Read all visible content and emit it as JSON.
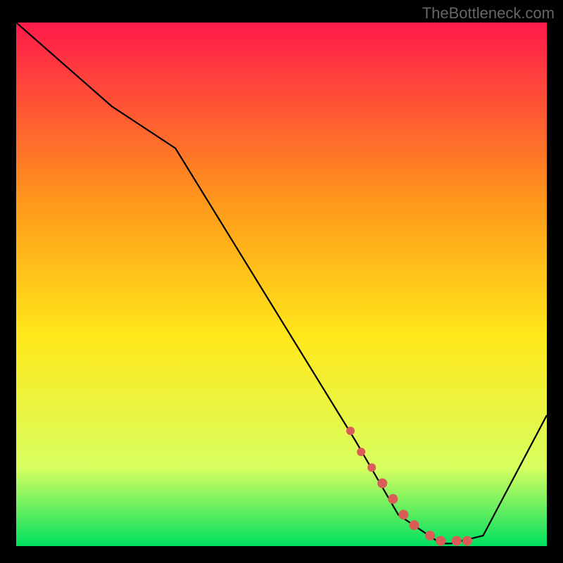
{
  "watermark": "TheBottleneck.com",
  "chart_data": {
    "type": "line",
    "title": "",
    "xlabel": "",
    "ylabel": "",
    "xlim": [
      0,
      100
    ],
    "ylim": [
      0,
      100
    ],
    "background": "rainbow-gradient-red-to-green-vertical",
    "series": [
      {
        "name": "curve",
        "color": "#000000",
        "x": [
          0,
          18,
          30,
          64,
          72,
          80,
          82,
          88,
          100
        ],
        "y": [
          100,
          84,
          76,
          20,
          6,
          0.5,
          0.5,
          2,
          25
        ]
      },
      {
        "name": "highlight-band",
        "color": "#d95c57",
        "type": "scatter",
        "x": [
          63,
          65,
          67,
          69,
          71,
          73,
          75,
          78,
          80,
          83,
          85
        ],
        "y": [
          22,
          18,
          15,
          12,
          9,
          6,
          4,
          2,
          1,
          1,
          1
        ]
      }
    ]
  },
  "colors": {
    "grad_top": "#ff1a4b",
    "grad_q1": "#ff9a1a",
    "grad_mid": "#ffe81a",
    "grad_q3": "#d8ff60",
    "grad_bot": "#00e060",
    "curve": "#000000",
    "dots": "#d95c57"
  }
}
